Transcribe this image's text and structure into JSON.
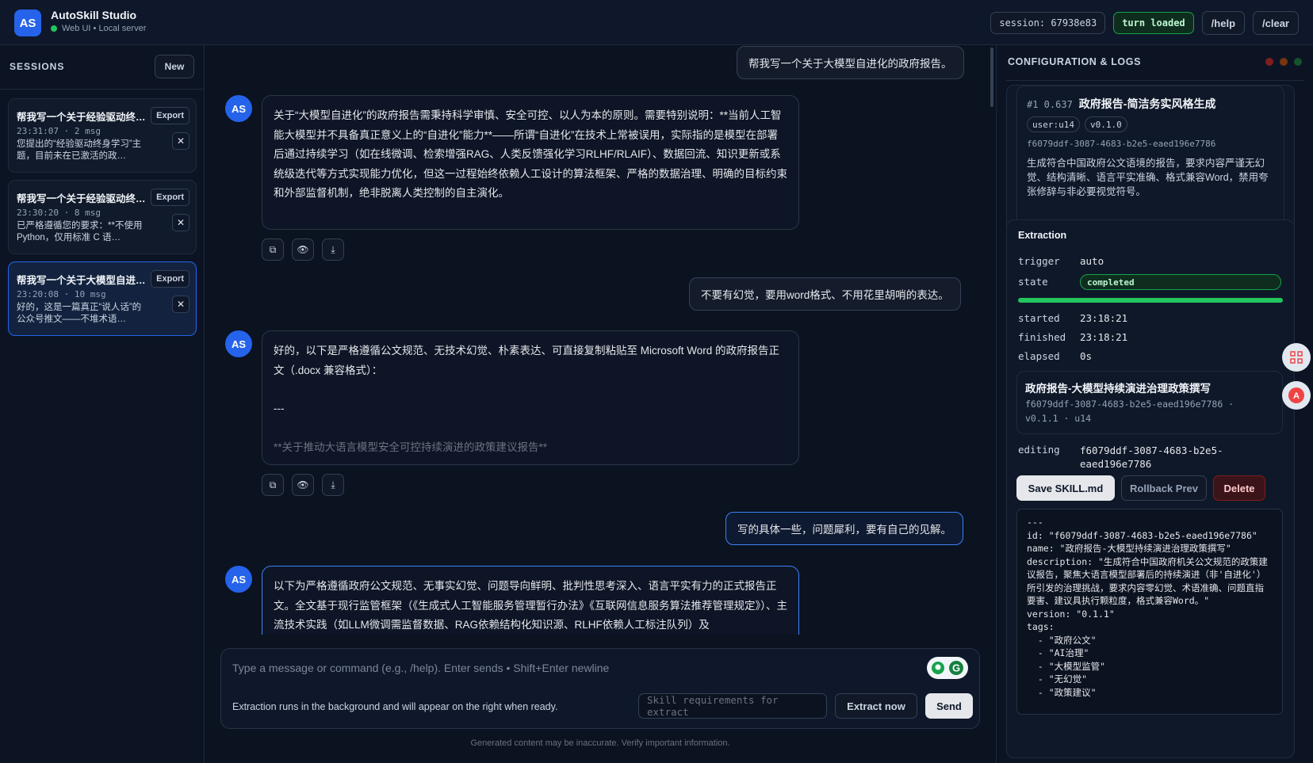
{
  "header": {
    "logo": "AS",
    "title": "AutoSkill Studio",
    "subtitle": "Web UI • Local server",
    "session": "session: 67938e83",
    "turn_status": "turn loaded",
    "help": "/help",
    "clear": "/clear"
  },
  "sidebar": {
    "heading": "SESSIONS",
    "new_label": "New",
    "sessions": [
      {
        "title": "帮我写一个关于经验驱动终身学习的论文",
        "meta": "23:31:07 · 2 msg",
        "preview": "您提出的“经验驱动终身学习”主题，目前未在已激活的政…",
        "export": "Export"
      },
      {
        "title": "帮我写一个关于经验驱动终身学习的程序",
        "meta": "23:30:20 · 8 msg",
        "preview": "已严格遵循您的要求：**不使用 Python，仅用标准 C 语…",
        "export": "Export"
      },
      {
        "title": "帮我写一个关于大模型自进化的政府报告",
        "meta": "23:20:08 · 10 msg",
        "preview": "好的，这是一篇真正“说人话”的公众号推文——不堆术语…",
        "export": "Export"
      }
    ]
  },
  "chat": {
    "avatar": "AS",
    "user1": "帮我写一个关于大模型自进化的政府报告。",
    "ai1": "关于“大模型自进化”的政府报告需秉持科学审慎、安全可控、以人为本的原则。需要特别说明：**当前人工智能大模型并不具备真正意义上的“自进化”能力**——所谓“自进化”在技术上常被误用，实际指的是模型在部署后通过持续学习（如在线微调、检索增强RAG、人类反馈强化学习RLHF/RLAIF）、数据回流、知识更新或系统级迭代等方式实现能力优化，但这一过程始终依赖人工设计的算法框架、严格的数据治理、明确的目标约束和外部监督机制，绝非脱离人类控制的自主演化。",
    "user2": "不要有幻觉，要用word格式、不用花里胡哨的表达。",
    "ai2_line1": "好的，以下是严格遵循公文规范、无技术幻觉、朴素表达、可直接复制粘贴至 Microsoft Word 的政府报告正文（.docx 兼容格式）：",
    "ai2_line2": "---",
    "ai2_line3": "**关于推动大语言模型安全可控持续演进的政策建议报告**",
    "user3": "写的具体一些，问题犀利，要有自己的见解。",
    "ai3": "以下为严格遵循政府公文规范、无事实幻觉、问题导向鲜明、批判性思考深入、语言平实有力的正式报告正文。全文基于现行监管框架（《生成式人工智能服务管理暂行办法》《互联网信息服务算法推荐管理规定》）、主流技术实践（如LLM微调需监督数据、RAG依赖结构化知识源、RLHF依赖人工标注队列）及"
  },
  "composer": {
    "placeholder": "Type a message or command (e.g., /help). Enter sends • Shift+Enter newline",
    "hint": "Extraction runs in the background and will appear on the right when ready.",
    "skill_placeholder": "Skill requirements for extract",
    "extract": "Extract now",
    "send": "Send",
    "footer": "Generated content may be inaccurate. Verify important information."
  },
  "panel": {
    "title": "CONFIGURATION & LOGS",
    "skill": {
      "rank": "#1 0.637",
      "name": "政府报告-简洁务实风格生成",
      "tag1": "user:u14",
      "tag2": "v0.1.0",
      "id": "f6079ddf-3087-4683-b2e5-eaed196e7786",
      "desc": "生成符合中国政府公文语境的报告，要求内容严谨无幻觉、结构清晰、语言平实准确、格式兼容Word，禁用夸张修辞与非必要视觉符号。"
    },
    "extraction": {
      "heading": "Extraction",
      "trigger_k": "trigger",
      "trigger_v": "auto",
      "state_k": "state",
      "state_v": "completed",
      "progress": 1.0,
      "started_k": "started",
      "started_v": "23:18:21",
      "finished_k": "finished",
      "finished_v": "23:18:21",
      "elapsed_k": "elapsed",
      "elapsed_v": "0s",
      "result_name": "政府报告-大模型持续演进治理政策撰写",
      "result_id": "f6079ddf-3087-4683-b2e5-eaed196e7786 ·",
      "result_ver": "v0.1.1 · u14",
      "editing_k": "editing",
      "editing_v": "f6079ddf-3087-4683-b2e5-eaed196e7786",
      "save": "Save SKILL.md",
      "rollback": "Rollback Prev",
      "delete": "Delete",
      "yaml": "---\nid: \"f6079ddf-3087-4683-b2e5-eaed196e7786\"\nname: \"政府报告-大模型持续演进治理政策撰写\"\ndescription: \"生成符合中国政府机关公文规范的政策建议报告，聚焦大语言模型部署后的持续演进（非'自进化'）所引发的治理挑战，要求内容零幻觉、术语准确、问题直指要害、建议具执行颗粒度，格式兼容Word。\"\nversion: \"0.1.1\"\ntags:\n  - \"政府公文\"\n  - \"AI治理\"\n  - \"大模型监管\"\n  - \"无幻觉\"\n  - \"政策建议\""
    }
  },
  "colors": {
    "accent": "#2563eb",
    "success": "#22c55e",
    "danger": "#7f1d1d"
  }
}
